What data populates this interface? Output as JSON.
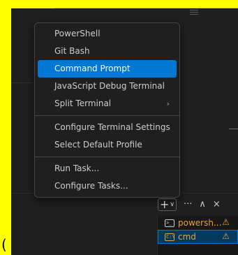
{
  "menu": {
    "items": [
      {
        "label": "PowerShell"
      },
      {
        "label": "Git Bash"
      },
      {
        "label": "Command Prompt",
        "active": true
      },
      {
        "label": "JavaScript Debug Terminal"
      },
      {
        "label": "Split Terminal",
        "submenu": true
      }
    ],
    "group2": [
      {
        "label": "Configure Terminal Settings"
      },
      {
        "label": "Select Default Profile"
      }
    ],
    "group3": [
      {
        "label": "Run Task..."
      },
      {
        "label": "Configure Tasks..."
      }
    ],
    "submenu_glyph": "›"
  },
  "toolbar": {
    "plus": "+",
    "caret": "∨",
    "more": "···",
    "maximize": "∧",
    "close": "×"
  },
  "terminals": [
    {
      "name": "powersh...",
      "icon": "terminal-icon",
      "icon_glyph": ">_",
      "warning": "⚠"
    },
    {
      "name": "cmd",
      "icon": "cmd-icon",
      "icon_glyph": "C:\\",
      "warning": "⚠",
      "selected": true
    }
  ],
  "fragment": "(",
  "colors": {
    "accent": "#0078d4",
    "warning": "#e8a23a",
    "highlight": "#ffff00",
    "panel": "#1f1f1f"
  }
}
